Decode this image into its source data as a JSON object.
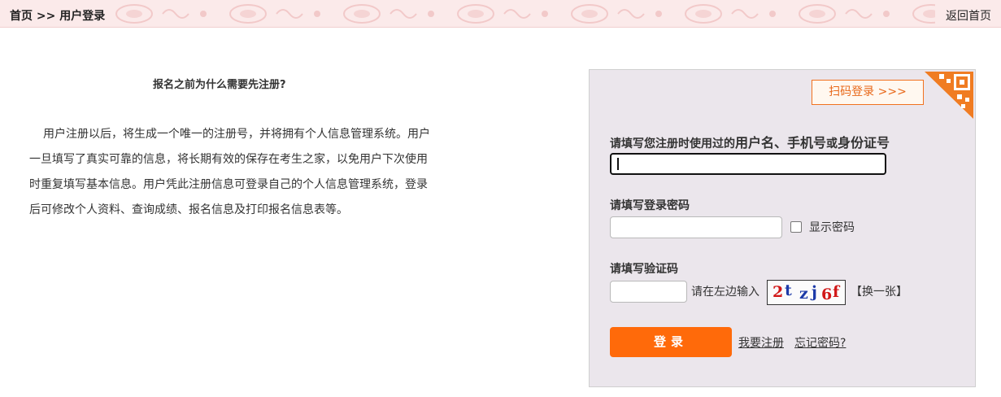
{
  "header": {
    "breadcrumb": "首页 >> 用户登录",
    "back_home": "返回首页"
  },
  "intro": {
    "title": "报名之前为什么需要先注册?",
    "body": "用户注册以后，将生成一个唯一的注册号，并将拥有个人信息管理系统。用户一旦填写了真实可靠的信息，将长期有效的保存在考生之家，以免用户下次使用时重复填写基本信息。用户凭此注册信息可登录自己的个人信息管理系统，登录后可修改个人资料、查询成绩、报名信息及打印报名信息表等。"
  },
  "login": {
    "scan_login": "扫码登录 >>>",
    "username_label_prefix": "请填写您注册时使用过的",
    "username_label_emph1": "用户名、手机号",
    "username_label_or": "或",
    "username_label_emph2": "身份证号",
    "username_value": "",
    "password_label": "请填写登录密码",
    "password_value": "",
    "show_password": "显示密码",
    "captcha_label": "请填写验证码",
    "captcha_value": "",
    "captcha_hint": "请在左边输入",
    "captcha_text": "2tzj6f",
    "captcha_chars": [
      "2",
      "t",
      "z",
      "j",
      "6",
      "f"
    ],
    "captcha_refresh": "【换一张】",
    "login_button": "登录",
    "register_link": "我要注册",
    "forgot_link": "忘记密码?"
  },
  "colors": {
    "accent": "#ff6a0a",
    "scan_border": "#f1721f",
    "panel_bg": "#ebe6ec",
    "header_bg": "#fbeaea"
  },
  "icons": {
    "qr": "qr-code-corner-icon"
  }
}
